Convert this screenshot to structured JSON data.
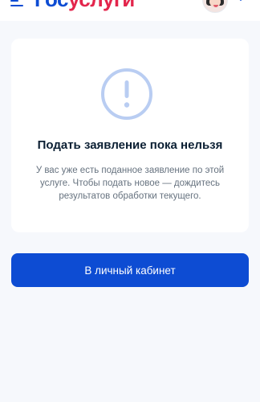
{
  "header": {
    "logo_part1": "Гос",
    "logo_part2": "услуги",
    "menu_icon": "menu-icon",
    "avatar_icon": "avatar",
    "dropdown_icon": "chevron-down-icon"
  },
  "card": {
    "icon": "exclamation-circle-icon",
    "title": "Подать заявление пока нельзя",
    "text": "У вас уже есть поданное заявление по этой услуге. Чтобы подать новое — дождитесь результатов обработки текущего."
  },
  "actions": {
    "primary_label": "В личный кабинет"
  },
  "colors": {
    "brand_blue": "#0d4cd3",
    "brand_red": "#e3254c",
    "icon_light_blue": "#b9cdf2",
    "background": "#f6f8fc"
  }
}
